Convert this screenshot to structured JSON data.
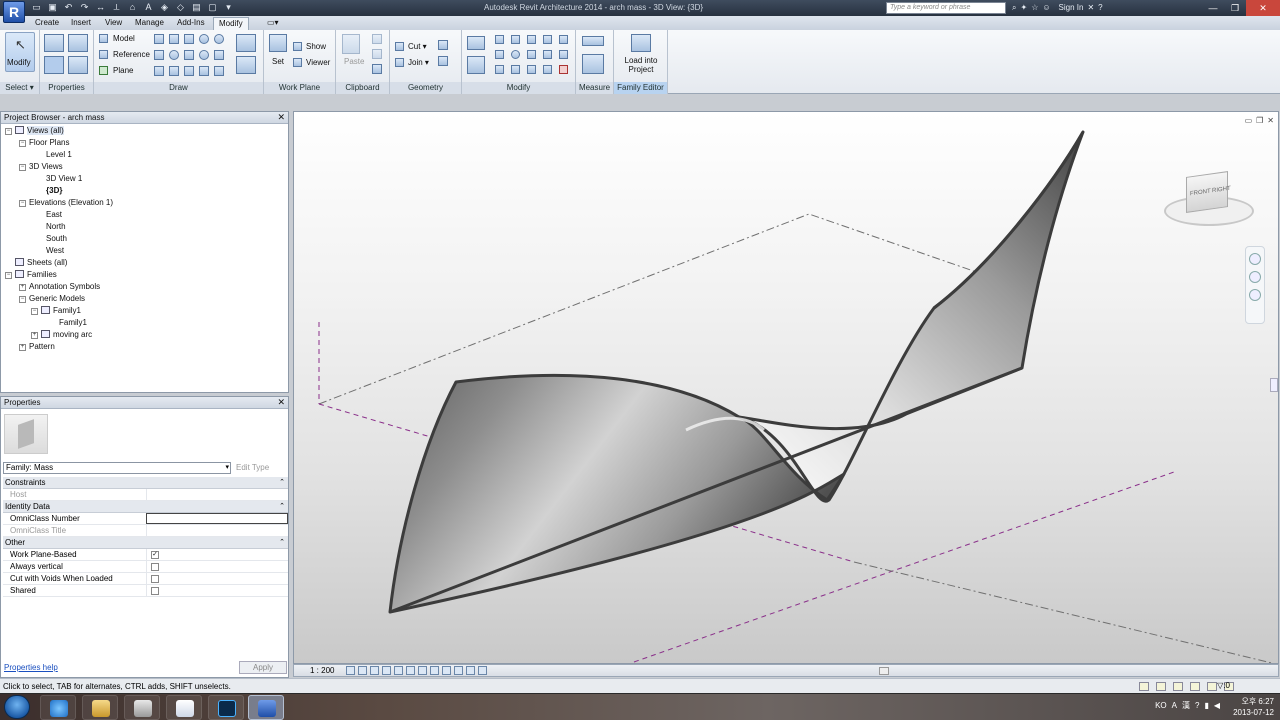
{
  "window": {
    "title": "Autodesk Revit Architecture 2014 -     arch mass - 3D View: {3D}",
    "search_placeholder": "Type a keyword or phrase",
    "sign_in": "Sign In",
    "logo_letter": "R"
  },
  "tabs": [
    "Create",
    "Insert",
    "View",
    "Manage",
    "Add-Ins",
    "Modify"
  ],
  "active_tab": "Modify",
  "ribbon": {
    "modify_label": "Modify",
    "select_label": "Select",
    "draw": {
      "model": "Model",
      "reference": "Reference",
      "plane": "Plane"
    },
    "work_plane": {
      "set": "Set",
      "show": "Show",
      "viewer": "Viewer"
    },
    "clipboard": {
      "paste": "Paste"
    },
    "geometry": {
      "cut": "Cut",
      "join": "Join"
    },
    "family_editor": {
      "load": "Load into Project"
    },
    "panels": [
      "Select",
      "Properties",
      "Draw",
      "Work Plane",
      "Clipboard",
      "Geometry",
      "Modify",
      "Measure",
      "Family Editor"
    ]
  },
  "project_browser": {
    "title": "Project Browser - arch mass",
    "items": [
      {
        "label": "Views (all)",
        "toggle": "−"
      },
      {
        "label": "Floor Plans",
        "toggle": "−"
      },
      {
        "label": "Level 1",
        "toggle": ""
      },
      {
        "label": "3D Views",
        "toggle": "−"
      },
      {
        "label": "3D View 1",
        "toggle": ""
      },
      {
        "label": "{3D}",
        "toggle": ""
      },
      {
        "label": "Elevations (Elevation 1)",
        "toggle": "−"
      },
      {
        "label": "East",
        "toggle": ""
      },
      {
        "label": "North",
        "toggle": ""
      },
      {
        "label": "South",
        "toggle": ""
      },
      {
        "label": "West",
        "toggle": ""
      },
      {
        "label": "Sheets (all)",
        "toggle": ""
      },
      {
        "label": "Families",
        "toggle": "−"
      },
      {
        "label": "Annotation Symbols",
        "toggle": "+"
      },
      {
        "label": "Generic Models",
        "toggle": "−"
      },
      {
        "label": "Family1",
        "toggle": "−"
      },
      {
        "label": "Family1",
        "toggle": ""
      },
      {
        "label": "moving arc",
        "toggle": "+"
      },
      {
        "label": "Pattern",
        "toggle": "+"
      }
    ]
  },
  "properties": {
    "title": "Properties",
    "type_selector": "Family: Mass",
    "edit_type": "Edit Type",
    "groups": {
      "constraints": "Constraints",
      "identity": "Identity Data",
      "other": "Other"
    },
    "rows": {
      "host": "Host",
      "omniclass_number": "OmniClass Number",
      "omniclass_title": "OmniClass Title",
      "work_plane_based": "Work Plane-Based",
      "always_vertical": "Always vertical",
      "cut_with_voids": "Cut with Voids When Loaded",
      "shared": "Shared"
    },
    "checks": {
      "work_plane_based": true,
      "always_vertical": false,
      "cut_with_voids": false,
      "shared": false
    },
    "help_link": "Properties help",
    "apply": "Apply"
  },
  "viewcube": {
    "front": "FRONT",
    "right": "RIGHT"
  },
  "view_bar": {
    "scale": "1 : 200"
  },
  "status_bar": {
    "text": "Click to select, TAB for alternates, CTRL adds, SHIFT unselects.",
    "filter": ":0"
  },
  "taskbar": {
    "lang": "KO",
    "clock_line1": "오후 6:27",
    "clock_line2": "2013-07-12"
  },
  "colors": {
    "ribbon_title_bg": "#d7dee8",
    "family_editor_highlight": "#b8d3f0",
    "surface_edge": "#3c3c3c",
    "plane_dash": "#8a2f8a"
  }
}
